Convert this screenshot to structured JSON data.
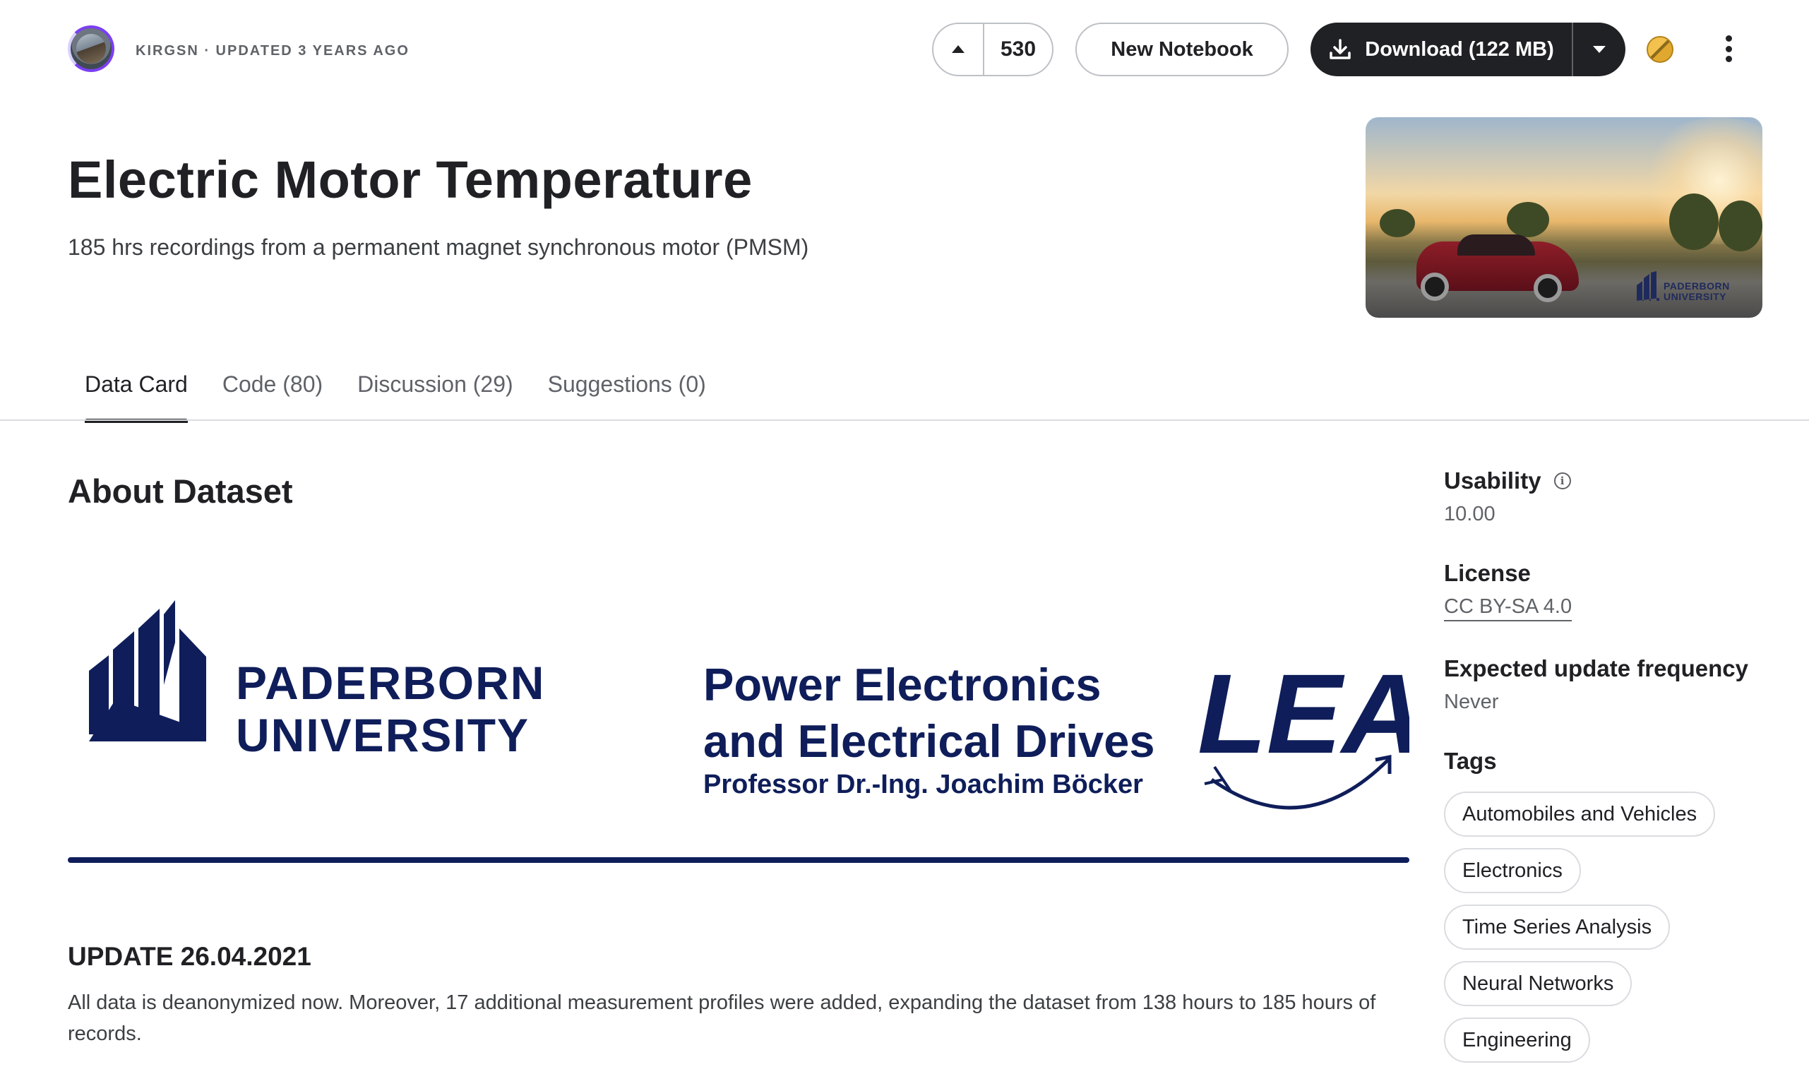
{
  "header": {
    "byline": "KIRGSN · UPDATED 3 YEARS AGO",
    "vote_count": "530",
    "new_notebook_label": "New Notebook",
    "download_label": "Download (122 MB)"
  },
  "dataset": {
    "title": "Electric Motor Temperature",
    "subtitle": "185 hrs recordings from a permanent magnet synchronous motor (PMSM)",
    "cover_logo_line1": "PADERBORN",
    "cover_logo_line2": "UNIVERSITY"
  },
  "tabs": [
    {
      "label": "Data Card"
    },
    {
      "label": "Code (80)"
    },
    {
      "label": "Discussion (29)"
    },
    {
      "label": "Suggestions (0)"
    }
  ],
  "about": {
    "heading": "About Dataset",
    "banner": {
      "university_line1": "PADERBORN",
      "university_line2": "UNIVERSITY",
      "dept_line1": "Power Electronics",
      "dept_line2": "and Electrical Drives",
      "professor": "Professor Dr.-Ing. Joachim Böcker",
      "lea_logo": "LEA"
    },
    "update_heading": "UPDATE 26.04.2021",
    "update_text": "All data is deanonymized now. Moreover, 17 additional measurement profiles were added, expanding the dataset from 138 hours to 185 hours of records."
  },
  "sidebar": {
    "usability_label": "Usability",
    "usability_value": "10.00",
    "license_label": "License",
    "license_value": "CC BY-SA 4.0",
    "frequency_label": "Expected update frequency",
    "frequency_value": "Never",
    "tags_label": "Tags",
    "tags": [
      "Automobiles and Vehicles",
      "Electronics",
      "Time Series Analysis",
      "Neural Networks",
      "Engineering"
    ]
  },
  "colors": {
    "brand_navy": "#0f1e5a",
    "primary_dark": "#202124",
    "avatar_ring": "#7b3ff2"
  },
  "icons": [
    "upvote-arrow-icon",
    "download-icon",
    "chevron-down-icon",
    "medal-icon",
    "kebab-menu-icon",
    "info-icon"
  ]
}
